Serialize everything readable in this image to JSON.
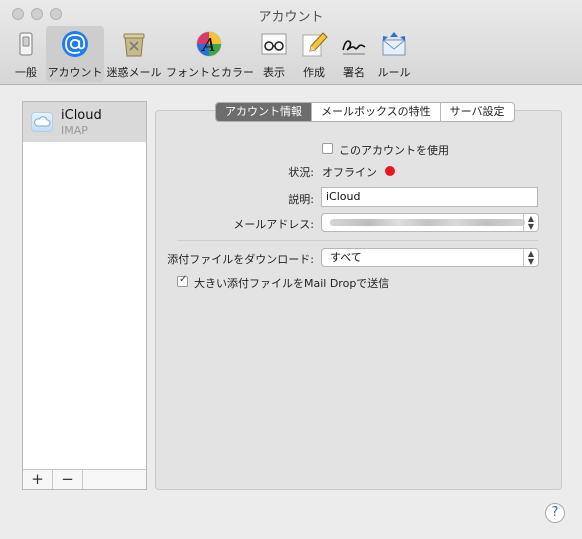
{
  "window": {
    "title": "アカウント"
  },
  "toolbar": {
    "items": [
      {
        "label": "一般",
        "icon": "general-switch-icon"
      },
      {
        "label": "アカウント",
        "icon": "at-sign-icon"
      },
      {
        "label": "迷惑メール",
        "icon": "junk-trash-icon"
      },
      {
        "label": "フォントとカラー",
        "icon": "fonts-colors-icon"
      },
      {
        "label": "表示",
        "icon": "viewing-glasses-icon"
      },
      {
        "label": "作成",
        "icon": "composing-pencil-icon"
      },
      {
        "label": "署名",
        "icon": "signature-icon"
      },
      {
        "label": "ルール",
        "icon": "rules-envelope-icon"
      }
    ],
    "active_index": 1
  },
  "sidebar": {
    "accounts": [
      {
        "name": "iCloud",
        "type": "IMAP",
        "icon": "icloud-icon"
      }
    ],
    "add_label": "+",
    "remove_label": "−"
  },
  "tabs": {
    "items": [
      "アカウント情報",
      "メールボックスの特性",
      "サーバ設定"
    ],
    "selected_index": 0
  },
  "form": {
    "enable_account_label": "このアカウントを使用",
    "enable_account_checked": false,
    "status_label": "状況:",
    "status_value": "オフライン",
    "status_color": "#e8161e",
    "description_label": "説明:",
    "description_value": "iCloud",
    "email_label": "メールアドレス:",
    "email_value": "",
    "download_label": "添付ファイルをダウンロード:",
    "download_value": "すべて",
    "maildrop_label": "大きい添付ファイルをMail Dropで送信",
    "maildrop_checked": true
  },
  "help": {
    "label": "?"
  },
  "colors": {
    "accent": "#1e7cf2",
    "selected_tab": "#6d6d6d",
    "status_offline": "#e8161e"
  }
}
